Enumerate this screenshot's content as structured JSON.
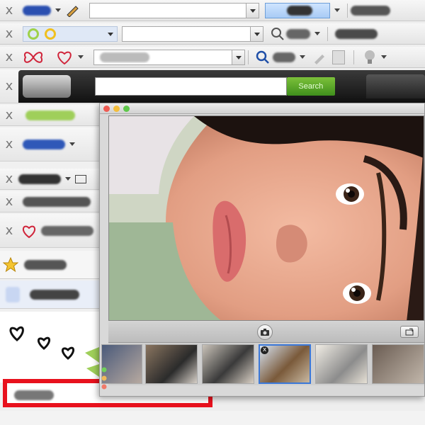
{
  "toolbar_rows": [
    {
      "close": "x"
    },
    {
      "close": "x"
    },
    {
      "close": "x"
    }
  ],
  "left_rows": [
    {
      "close": "x"
    },
    {
      "close": "x"
    },
    {
      "close": "x"
    },
    {
      "close": "x"
    },
    {
      "close": "x"
    },
    {
      "close": "x"
    }
  ],
  "search_bar": {
    "button_label": "Search"
  },
  "photo_window": {
    "thumbnail_count": 6,
    "selected_thumbnail": 4,
    "thumb_remove": "x"
  },
  "colors": {
    "accent_green": "#4f9f26",
    "selection_blue": "#3b78d8",
    "red_frame": "#e8111d"
  },
  "icons": [
    "close-icon",
    "chevron-down-icon",
    "camera-icon",
    "share-icon",
    "heart-icon",
    "star-icon",
    "search-icon",
    "pencil-icon",
    "lightbulb-icon"
  ]
}
